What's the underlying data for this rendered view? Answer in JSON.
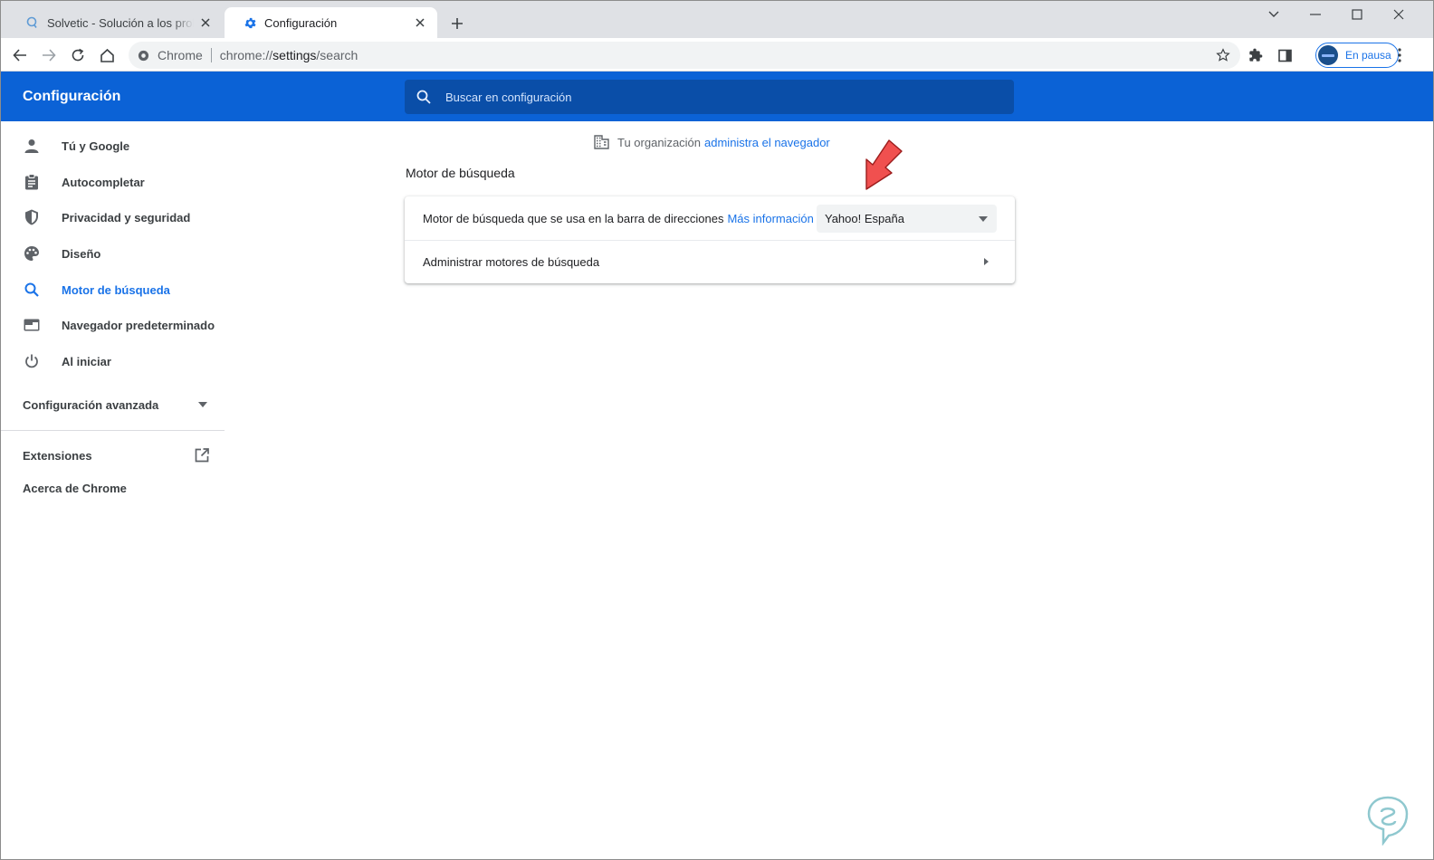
{
  "tabs": [
    {
      "title": "Solvetic - Solución a los problemas informáticos",
      "active": false,
      "icon": "solvetic-icon"
    },
    {
      "title": "Configuración",
      "active": true,
      "icon": "gear-icon"
    }
  ],
  "toolbar": {
    "site_label": "Chrome",
    "url_scheme": "chrome://",
    "url_host": "settings",
    "url_path": "/search",
    "profile_label": "En pausa"
  },
  "header": {
    "title": "Configuración",
    "search_placeholder": "Buscar en configuración"
  },
  "sidebar": {
    "items": [
      {
        "label": "Tú y Google",
        "icon": "person-icon"
      },
      {
        "label": "Autocompletar",
        "icon": "clipboard-icon"
      },
      {
        "label": "Privacidad y seguridad",
        "icon": "shield-icon"
      },
      {
        "label": "Diseño",
        "icon": "palette-icon"
      },
      {
        "label": "Motor de búsqueda",
        "icon": "search-icon",
        "selected": true
      },
      {
        "label": "Navegador predeterminado",
        "icon": "browser-icon"
      },
      {
        "label": "Al iniciar",
        "icon": "power-icon"
      }
    ],
    "advanced_label": "Configuración avanzada",
    "extensions_label": "Extensiones",
    "about_label": "Acerca de Chrome"
  },
  "main": {
    "managed_text": "Tu organización",
    "managed_link": "administra el navegador",
    "section_title": "Motor de búsqueda",
    "search_engine_row": {
      "label": "Motor de búsqueda que se usa en la barra de direcciones",
      "link": "Más información",
      "selected_value": "Yahoo! España"
    },
    "manage_row_label": "Administrar motores de búsqueda"
  },
  "colors": {
    "header_blue": "#0b62d6",
    "accent": "#1a73e8",
    "annotation_arrow": "#f0504f"
  }
}
